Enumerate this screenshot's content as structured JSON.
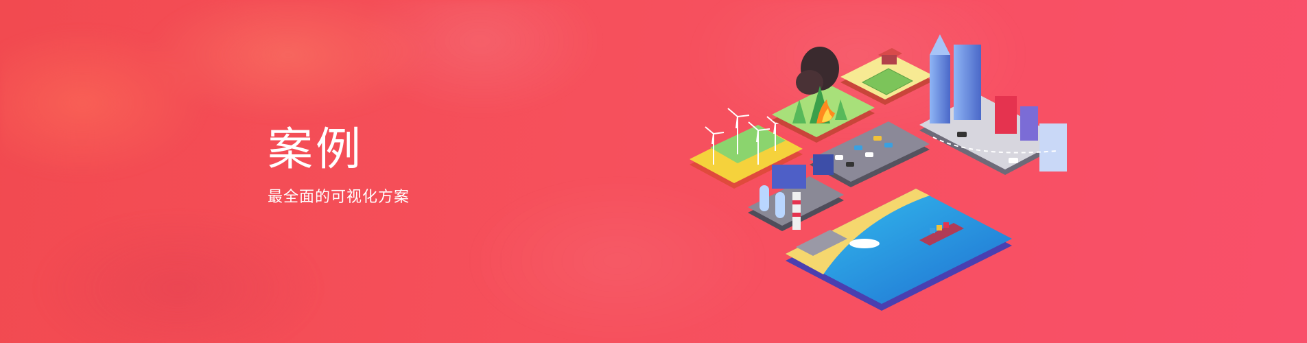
{
  "hero": {
    "title": "案例",
    "subtitle": "最全面的可视化方案"
  },
  "illustration": {
    "name": "isometric-smart-city",
    "tiles": [
      "wind-farm",
      "forest-fire",
      "farm",
      "downtown",
      "parking-lot",
      "factory",
      "harbor"
    ]
  },
  "colors": {
    "background_start": "#f24a50",
    "background_end": "#f9506a",
    "text": "#ffffff",
    "sea": "#2ea6e6",
    "grass": "#9be27a",
    "sand": "#f5d76e"
  }
}
